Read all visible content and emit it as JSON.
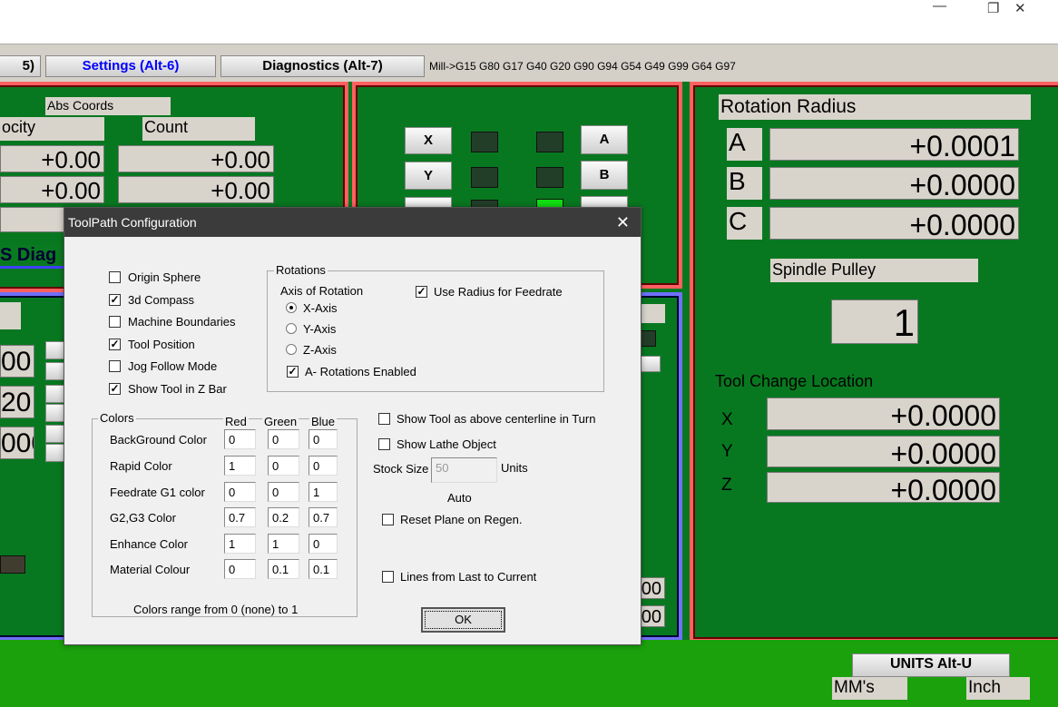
{
  "window": {
    "minimize": "—",
    "restore": "❐",
    "close": "✕"
  },
  "toolbar": {
    "tab_prev": "5)",
    "settings": "Settings (Alt-6)",
    "diagnostics": "Diagnostics (Alt-7)",
    "gcode_status": "Mill->G15  G80 G17 G40 G20 G90 G94 G54 G49 G99 G64 G97",
    "accent": "#0000ff"
  },
  "left_panel": {
    "abs_coords": "Abs Coords",
    "velocity": "ocity",
    "count": "Count",
    "rows": [
      [
        "+0.00",
        "+0.00"
      ],
      [
        "+0.00",
        "+0.00"
      ],
      [
        "+(",
        ""
      ]
    ],
    "diag": "S Diag",
    "values": [
      "00",
      "20",
      "000"
    ]
  },
  "middle_panel": {
    "x": "X",
    "y": "Y",
    "a": "A",
    "b": "B"
  },
  "right_panel": {
    "rotation_radius": "Rotation Radius",
    "axes": [
      {
        "label": "A",
        "value": "+0.0001"
      },
      {
        "label": "B",
        "value": "+0.0000"
      },
      {
        "label": "C",
        "value": "+0.0000"
      }
    ],
    "spindle_pulley": "Spindle Pulley",
    "pulley_value": "1",
    "tool_change": "Tool Change Location",
    "tool_axes": [
      {
        "label": "X",
        "value": "+0.0000"
      },
      {
        "label": "Y",
        "value": "+0.0000"
      },
      {
        "label": "Z",
        "value": "+0.0000"
      }
    ],
    "units_button": "UNITS Alt-U",
    "mm": "MM's",
    "inch": "Inch"
  },
  "lower_mid": {
    "values": [
      "00",
      "00"
    ]
  },
  "dialog": {
    "title": "ToolPath Configuration",
    "close": "✕",
    "options": [
      {
        "label": "Origin Sphere",
        "checked": false
      },
      {
        "label": "3d Compass",
        "checked": true
      },
      {
        "label": "Machine Boundaries",
        "checked": false
      },
      {
        "label": "Tool Position",
        "checked": true
      },
      {
        "label": "Jog Follow Mode",
        "checked": false
      },
      {
        "label": "Show Tool in Z Bar",
        "checked": true
      }
    ],
    "rotations": {
      "title": "Rotations",
      "axis_label": "Axis of Rotation",
      "axes": [
        {
          "label": "X-Axis",
          "selected": true
        },
        {
          "label": "Y-Axis",
          "selected": false
        },
        {
          "label": "Z-Axis",
          "selected": false
        }
      ],
      "use_radius": {
        "label": "Use Radius for Feedrate",
        "checked": true
      },
      "a_rotations": {
        "label": "A- Rotations Enabled",
        "checked": true
      }
    },
    "colors": {
      "title": "Colors",
      "headers": [
        "Red",
        "Green",
        "Blue"
      ],
      "rows": [
        {
          "label": "BackGround Color",
          "values": [
            "0",
            "0",
            "0"
          ]
        },
        {
          "label": "Rapid Color",
          "values": [
            "1",
            "0",
            "0"
          ]
        },
        {
          "label": "Feedrate G1 color",
          "values": [
            "0",
            "0",
            "1"
          ]
        },
        {
          "label": "G2,G3 Color",
          "values": [
            "0.7",
            "0.2",
            "0.7"
          ]
        },
        {
          "label": "Enhance Color",
          "values": [
            "1",
            "1",
            "0"
          ]
        },
        {
          "label": "Material Colour",
          "values": [
            "0",
            "0.1",
            "0.1"
          ]
        }
      ],
      "note": "Colors range from 0 (none) to 1"
    },
    "lathe": {
      "show_tool": {
        "label": "Show Tool as above centerline in Turn",
        "checked": false
      },
      "show_lathe": {
        "label": "Show Lathe Object",
        "checked": false
      },
      "stock_label": "Stock Size",
      "stock_value": "50",
      "units": "Units",
      "auto": "Auto",
      "reset_plane": {
        "label": "Reset Plane on Regen.",
        "checked": false
      },
      "lines_last": {
        "label": "Lines from Last to Current",
        "checked": false
      }
    },
    "ok": "OK"
  }
}
